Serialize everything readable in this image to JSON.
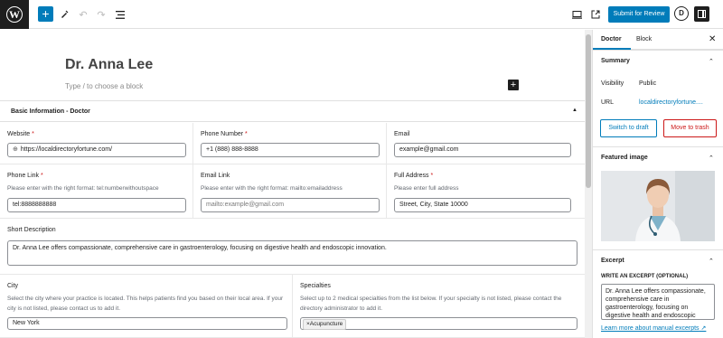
{
  "toolbar": {
    "submit_label": "Submit for Review",
    "avatar_letter": "D",
    "icons": [
      "wordpress-logo",
      "add-block",
      "pen-tool",
      "undo",
      "redo",
      "document-overview",
      "desktop-preview",
      "external-view",
      "settings"
    ]
  },
  "editor": {
    "post_title": "Dr. Anna Lee",
    "block_placeholder": "Type / to choose a block",
    "metabox_title": "Basic Information - Doctor",
    "fields": {
      "website": {
        "label": "Website",
        "required": "*",
        "value": "https://localdirectoryfortune.com/"
      },
      "phone_number": {
        "label": "Phone Number",
        "required": "*",
        "value": "+1 (888) 888-8888"
      },
      "email": {
        "label": "Email",
        "value": "example@gmail.com"
      },
      "phone_link": {
        "label": "Phone Link",
        "required": "*",
        "description": "Please enter with the right format: tel:numberwithoutspace",
        "value": "tel:8888888888"
      },
      "email_link": {
        "label": "Email Link",
        "description": "Please enter with the right format: mailto:emailaddress",
        "placeholder": "mailto:example@gmail.com"
      },
      "full_address": {
        "label": "Full Address",
        "required": "*",
        "description": "Please enter full address",
        "value": "Street, City, State 10000"
      },
      "short_description": {
        "label": "Short Description",
        "value": "Dr. Anna Lee offers compassionate, comprehensive care in gastroenterology, focusing on digestive health and endoscopic innovation."
      },
      "city": {
        "label": "City",
        "description": "Select the city where your practice is located. This helps patients find you based on their local area. If your city is not listed, please contact us to add it.",
        "value": "New York"
      },
      "specialties": {
        "label": "Specialties",
        "description": "Select up to 2 medical specialties from the list below. If your specialty is not listed, please contact the directory administrator to add it.",
        "tag": "Acupuncture",
        "tag_remove": "×"
      }
    }
  },
  "sidebar": {
    "tabs": [
      "Doctor",
      "Block"
    ],
    "summary": {
      "title": "Summary",
      "visibility_label": "Visibility",
      "visibility_value": "Public",
      "url_label": "URL",
      "url_value": "localdirectoryfortune...."
    },
    "switch_draft": "Switch to draft",
    "move_trash": "Move to trash",
    "featured_title": "Featured image",
    "excerpt": {
      "title": "Excerpt",
      "label": "WRITE AN EXCERPT (OPTIONAL)",
      "text": "Dr. Anna Lee offers compassionate, comprehensive care in gastroenterology, focusing on digestive health and endoscopic innovation.",
      "link": "Learn more about manual excerpts"
    }
  },
  "colors": {
    "accent": "#007cba",
    "danger": "#cc1818",
    "dark": "#1e1e1e"
  }
}
